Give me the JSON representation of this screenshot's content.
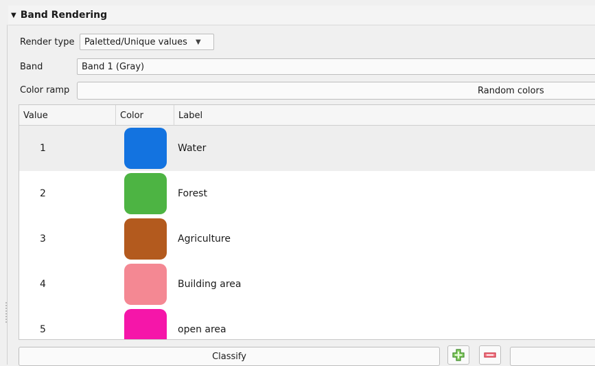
{
  "section": {
    "title": "Band Rendering"
  },
  "render_type": {
    "label": "Render type",
    "value": "Paletted/Unique values"
  },
  "band": {
    "label": "Band",
    "value": "Band 1 (Gray)"
  },
  "color_ramp": {
    "label": "Color ramp",
    "value": "Random colors"
  },
  "table": {
    "headers": {
      "value": "Value",
      "color": "Color",
      "label": "Label"
    },
    "rows": [
      {
        "value": "1",
        "color": "#1373E0",
        "label": "Water"
      },
      {
        "value": "2",
        "color": "#4DB443",
        "label": "Forest"
      },
      {
        "value": "3",
        "color": "#B35A1E",
        "label": "Agriculture"
      },
      {
        "value": "4",
        "color": "#F48893",
        "label": "Building area"
      },
      {
        "value": "5",
        "color": "#F516A9",
        "label": "open area"
      }
    ]
  },
  "footer": {
    "classify_label": "Classify"
  },
  "icons": {
    "add": "plus-icon",
    "remove": "minus-icon"
  }
}
